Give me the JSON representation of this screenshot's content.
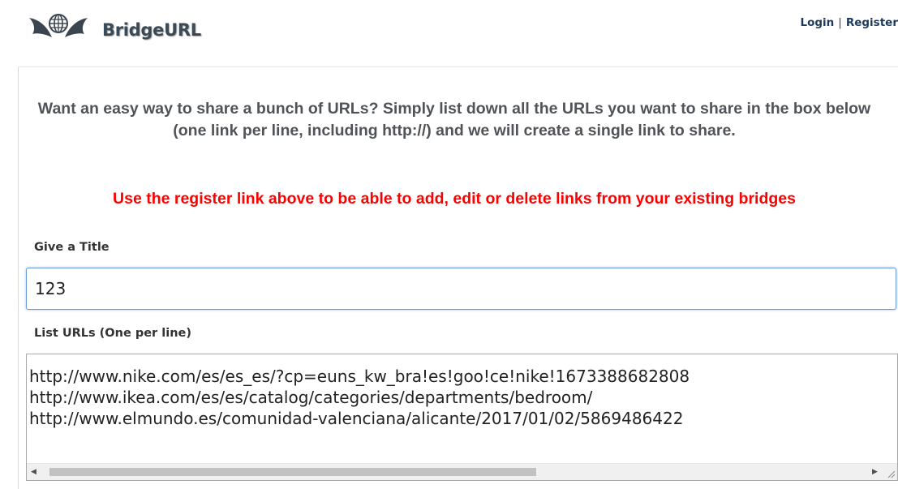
{
  "brand": {
    "name": "BridgeURL"
  },
  "nav": {
    "login_label": "Login",
    "separator": "|",
    "register_label": "Register"
  },
  "intro": {
    "text": "Want an easy way to share a bunch of URLs? Simply list down all the URLs you want to share in the box below (one link per line, including http://) and we will create a single link to share."
  },
  "notice": {
    "text": "Use the register link above to be able to add, edit or delete links from your existing bridges",
    "color": "#ff0000"
  },
  "form": {
    "title_label": "Give a Title",
    "title_value": "123",
    "urls_label": "List URLs (One per line)",
    "urls": [
      "http://www.nike.com/es/es_es/?cp=euns_kw_bra!es!goo!ce!nike!1673388682808",
      "http://www.ikea.com/es/es/catalog/categories/departments/bedroom/",
      "http://www.elmundo.es/comunidad-valenciana/alicante/2017/01/02/5869486422"
    ]
  },
  "colors": {
    "input_focus_border": "#6b9bd8",
    "text_gray": "#505458"
  }
}
